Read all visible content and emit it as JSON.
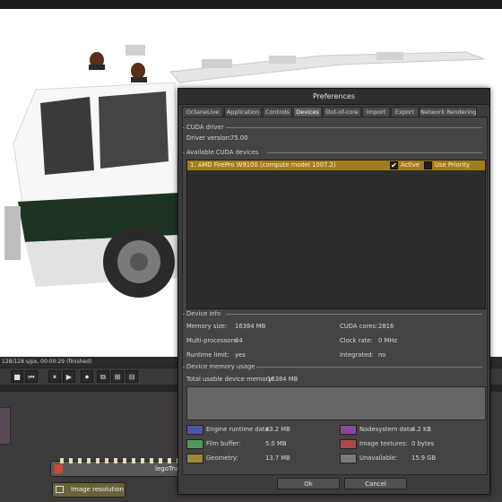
{
  "app": {
    "status_line": "128/128 s/px, 00:00:29 (finished)"
  },
  "transport": {
    "buttons": [
      "■",
      "⏮",
      "⏸",
      "▶",
      "⏺",
      "⧉",
      "⊞",
      "⊟"
    ]
  },
  "nodegraph": {
    "mesh_node_label": "legoTruc",
    "image_res_node_label": "Image resolution"
  },
  "dialog": {
    "title": "Preferences",
    "tabs": [
      "OctaneLive",
      "Application",
      "Controls",
      "Devices",
      "Out-of-core",
      "Import",
      "Export",
      "Network Rendering"
    ],
    "active_tab": "Devices",
    "cuda_driver": {
      "header": "CUDA driver",
      "driver_version_label": "Driver version:",
      "driver_version_value": "75.00"
    },
    "available_devices": {
      "header": "Available CUDA devices",
      "device_name": "1: AMD FirePro W9100 (compute model 1007.2)",
      "active_label": "Active",
      "active_checked": true,
      "use_priority_label": "Use Priority",
      "use_priority_checked": false
    },
    "device_info": {
      "header": "Device info",
      "memory_size_label": "Memory size:",
      "memory_size_value": "16384 MB",
      "multiprocessors_label": "Multi-processors:",
      "multiprocessors_value": "44",
      "runtime_limit_label": "Runtime limit:",
      "runtime_limit_value": "yes",
      "cuda_cores_label": "CUDA cores:",
      "cuda_cores_value": "2816",
      "clock_rate_label": "Clock rate:",
      "clock_rate_value": "0 MHz",
      "integrated_label": "Integrated:",
      "integrated_value": "no"
    },
    "memory_usage": {
      "header": "Device memory usage",
      "total_label": "Total usable device memory:",
      "total_value": "16384 MB",
      "legend": [
        {
          "label": "Engine runtime data:",
          "value": "43.2 MB",
          "color": "#4a58a8"
        },
        {
          "label": "Film buffer:",
          "value": "5.0 MB",
          "color": "#4f9a58"
        },
        {
          "label": "Geometry:",
          "value": "13.7 MB",
          "color": "#9a8a3a"
        },
        {
          "label": "Nodesystem data:",
          "value": "4.2 KB",
          "color": "#8a4a9a"
        },
        {
          "label": "Image textures:",
          "value": "0 bytes",
          "color": "#a84a4a"
        },
        {
          "label": "Unavailable:",
          "value": "15.9 GB",
          "color": "#7a7a7a"
        }
      ]
    },
    "ok_label": "Ok",
    "cancel_label": "Cancel"
  }
}
